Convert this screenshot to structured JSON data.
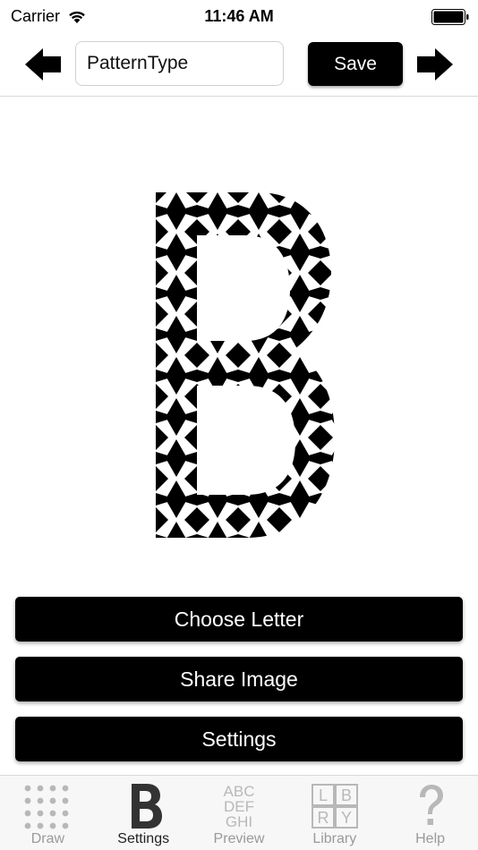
{
  "status_bar": {
    "carrier": "Carrier",
    "time": "11:46 AM"
  },
  "nav": {
    "pattern_name_value": "PatternType",
    "save_label": "Save"
  },
  "preview": {
    "letter": "B"
  },
  "actions": {
    "choose_letter": "Choose Letter",
    "share_image": "Share Image",
    "settings": "Settings"
  },
  "tabs": [
    {
      "label": "Draw",
      "icon": "dot-grid-icon",
      "active": false
    },
    {
      "label": "Settings",
      "icon": "letter-b-icon",
      "active": true
    },
    {
      "label": "Preview",
      "icon": "abc-grid-icon",
      "active": false
    },
    {
      "label": "Library",
      "icon": "library-blocks-icon",
      "active": false
    },
    {
      "label": "Help",
      "icon": "question-mark-icon",
      "active": false
    }
  ],
  "colors": {
    "accent": "#000000",
    "inactive_tab": "#9a9a9a",
    "active_tab": "#222222"
  }
}
